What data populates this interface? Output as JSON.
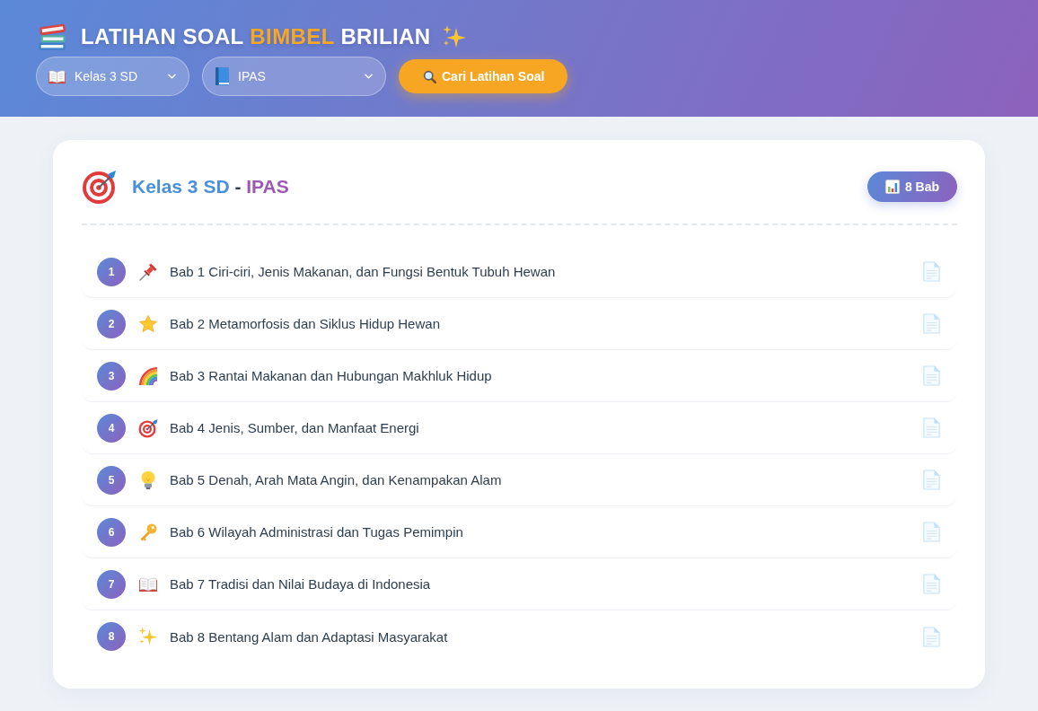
{
  "header": {
    "title": [
      {
        "text": "LATIHAN SOAL",
        "highlight": false
      },
      {
        "text": "BIMBEL",
        "highlight": true
      },
      {
        "text": "BRILIAN",
        "highlight": false
      }
    ],
    "filters": [
      {
        "kind": "grade",
        "value": "Kelas 3 SD"
      },
      {
        "kind": "subject",
        "value": "IPAS"
      }
    ],
    "search_button": "Cari Latihan Soal"
  },
  "card": {
    "title": {
      "grade": "Kelas 3 SD",
      "separator": "-",
      "subject": "IPAS"
    },
    "badge": "8 Bab",
    "chapters": [
      {
        "number": "1",
        "title": "Bab 1 Ciri-ciri, Jenis Makanan, dan Fungsi Bentuk Tubuh Hewan"
      },
      {
        "number": "2",
        "title": "Bab 2 Metamorfosis dan Siklus Hidup Hewan"
      },
      {
        "number": "3",
        "title": "Bab 3 Rantai Makanan dan Hubungan Makhluk Hidup"
      },
      {
        "number": "4",
        "title": "Bab 4 Jenis, Sumber, dan Manfaat Energi"
      },
      {
        "number": "5",
        "title": "Bab 5 Denah, Arah Mata Angin, dan Kenampakan Alam"
      },
      {
        "number": "6",
        "title": "Bab 6 Wilayah Administrasi dan Tugas Pemimpin"
      },
      {
        "number": "7",
        "title": "Bab 7 Tradisi dan Nilai Budaya di Indonesia"
      },
      {
        "number": "8",
        "title": "Bab 8 Bentang Alam dan Adaptasi Masyarakat"
      }
    ]
  }
}
